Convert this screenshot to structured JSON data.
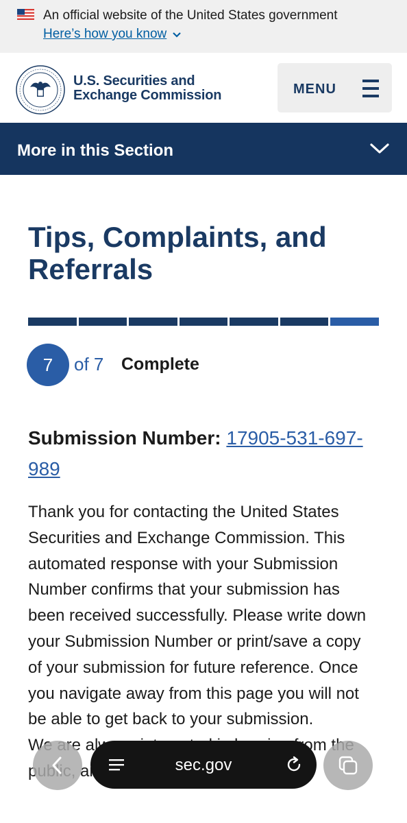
{
  "gov_banner": {
    "official_text": "An official website of the United States government",
    "how_you_know_link": "Here’s how you know"
  },
  "header": {
    "agency_line1": "U.S. Securities and",
    "agency_line2": "Exchange Commission",
    "menu_label": "MENU"
  },
  "section_nav": {
    "label": "More in this Section"
  },
  "page": {
    "title": "Tips, Complaints, and Referrals"
  },
  "progress": {
    "total_steps": 7,
    "current_step": 7,
    "step_number": "7",
    "of_text": "of 7",
    "status": "Complete"
  },
  "submission": {
    "label": "Submission Number:",
    "number": "17905-531-697-989"
  },
  "body_text": "Thank you for contacting the United States Securities and Exchange Commission. This automated response with your Submission Number confirms that your submission has been received successfully. Please write down your Submission Number or print/save a copy of your submission for future reference. Once you navigate away from this page you will not be able to get back to your submission.",
  "body_text_2": "We are always interested in hearing from the public, and your submission will be",
  "browser": {
    "url": "sec.gov"
  },
  "colors": {
    "navy": "#1a3a63",
    "section_bar": "#15355f",
    "accent_blue": "#2a5da6",
    "link_blue": "#005ea2",
    "banner_bg": "#f0f0f0"
  },
  "icons": [
    "us-flag-icon",
    "chevron-down-icon",
    "sec-seal-logo",
    "hamburger-icon",
    "chevron-down-icon",
    "back-arrow-icon",
    "menu-lines-icon",
    "reload-icon",
    "tabs-icon"
  ]
}
